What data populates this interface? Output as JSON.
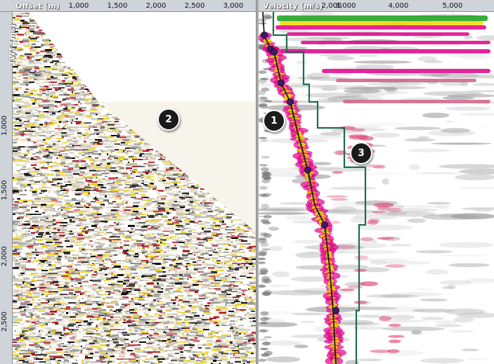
{
  "left": {
    "x_title": "Offset (m)",
    "x_ticks": [
      "1,000",
      "1,500",
      "2,000",
      "2,500",
      "3,000"
    ],
    "y_title": "TWT (ms)",
    "y_ticks": [
      "1,000",
      "1,500",
      "2,000",
      "2,500"
    ]
  },
  "right": {
    "x_title": "Velocity (m/s)",
    "x_ticks": [
      "2,000",
      "3,000",
      "4,000",
      "5,000"
    ]
  },
  "callouts": [
    "1",
    "2",
    "3"
  ],
  "colors": {
    "highlight_fill": "#f7f4ec",
    "pick_line": "#1a1a1a",
    "pick_marker": "#3f1a66",
    "interval_line": "#1f6b4f",
    "semblance_high": "#e0008a",
    "semblance_mid": "#f5d800",
    "semblance_peak": "#18a018"
  }
}
